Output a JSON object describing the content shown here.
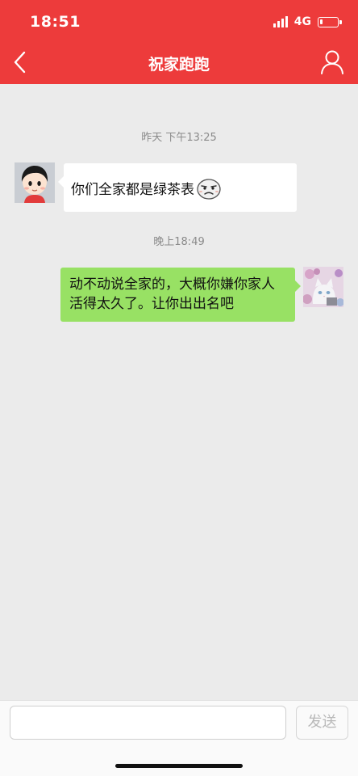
{
  "status_bar": {
    "time": "18:51",
    "network": "4G",
    "battery_percent": 15
  },
  "header": {
    "title": "祝家跑跑",
    "background_color": "#ed3b3b",
    "back_icon": "chevron-left-icon",
    "profile_icon": "user-profile-icon"
  },
  "chat": {
    "timestamps": [
      "昨天 下午13:25",
      "晚上18:49"
    ],
    "messages": [
      {
        "side": "left",
        "text": "你们全家都是绿茶表",
        "emoji": "disdain-face-emoji",
        "bubble_color": "#ffffff"
      },
      {
        "side": "right",
        "lines": [
          "动不动说全家的，大概你嫌你家人",
          "活得太久了。让你出出名吧"
        ],
        "bubble_color": "#98e164"
      }
    ]
  },
  "input_bar": {
    "value": "",
    "placeholder": "",
    "send_label": "发送"
  }
}
